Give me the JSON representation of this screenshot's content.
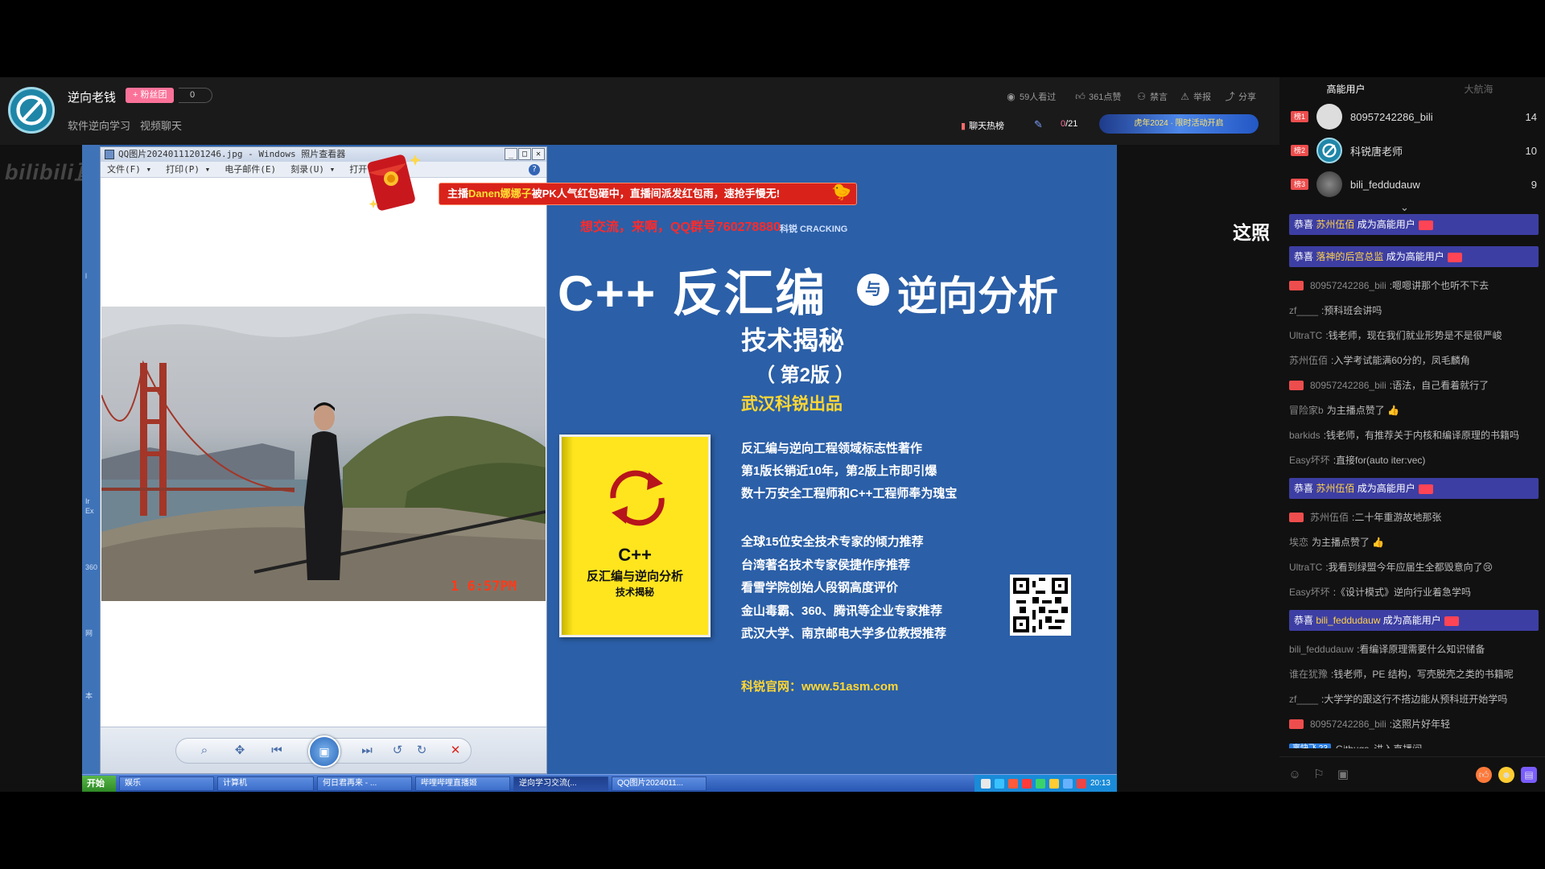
{
  "header": {
    "anchor_name": "逆向老钱",
    "fan_badge": "+ 粉丝团",
    "fan_count": "0",
    "tags": [
      "软件逆向学习",
      "视频聊天"
    ],
    "stats": {
      "viewers": "59人看过",
      "likes": "361点赞",
      "mute": "禁言",
      "report": "举报",
      "share": "分享"
    },
    "hot_rank": "聊天热榜",
    "progress_current": "0",
    "progress_total": "/21",
    "banner_text": "虎年2024 · 限时活动开启"
  },
  "stage": {
    "watermark": "bilibili直播",
    "left_strip_texts": [
      "l",
      "Ir",
      "Ex",
      "360",
      "网",
      "本"
    ],
    "viewer": {
      "title": "QQ图片20240111201246.jpg - Windows 照片查看器",
      "menu": [
        "文件(F) ▾",
        "打印(P) ▾",
        "电子邮件(E)",
        "刻录(U) ▾",
        "打开(O) ▾"
      ],
      "window_buttons": [
        "_",
        "□",
        "✕"
      ],
      "help": "?",
      "photo_timestamp": "1  6:57PM"
    },
    "notice": {
      "prefix": "主播",
      "highlight": "Danen娜娜子",
      "suffix": "被PK人气红包砸中，直播间派发红包雨，速抢手慢无!"
    },
    "poster": {
      "red_line": "想交流，来啊，QQ群号760278880",
      "logo": "科锐 CRACKING",
      "title_left": "C++ 反汇编",
      "title_and": "与",
      "title_right": "逆向分析",
      "subtitle": "技术揭秘",
      "edition": "（ 第2版 ）",
      "publisher": "武汉科锐出品",
      "points_1": [
        "反汇编与逆向工程领域标志性著作",
        "第1版长销近10年，第2版上市即引爆",
        "数十万安全工程师和C++工程师奉为瑰宝"
      ],
      "points_2": [
        "全球15位安全技术专家的倾力推荐",
        "台湾著名技术专家侯捷作序推荐",
        "看雪学院创始人段钢高度评价",
        "金山毒霸、360、腾讯等企业专家推荐",
        "武汉大学、南京邮电大学多位教授推荐"
      ],
      "website": "科锐官网：www.51asm.com",
      "book_title_1": "C++",
      "book_title_2": "反汇编与逆向分析",
      "book_title_3": "技术揭秘"
    },
    "overlay_text": "这照",
    "taskbar": {
      "start": "开始",
      "tasks": [
        "娱乐",
        "计算机",
        "何日君再来 - ...",
        "哔哩哔哩直播姬",
        "逆向学习交流(...",
        "QQ图片2024011..."
      ],
      "time": "20:13"
    }
  },
  "sidebar": {
    "tabs": [
      "高能用户",
      "大航海"
    ],
    "rank": [
      {
        "badge": "榜1",
        "name": "80957242286_bili",
        "score": "14"
      },
      {
        "badge": "榜2",
        "name": "科锐唐老师",
        "score": "10"
      },
      {
        "badge": "榜3",
        "name": "bili_feddudauw",
        "score": "9"
      }
    ],
    "chat": [
      {
        "type": "congrats",
        "prefix": "恭喜",
        "user": "苏州伍佰",
        "suffix": "成为高能用户"
      },
      {
        "type": "congrats",
        "prefix": "恭喜",
        "user": "落神的后宫总监",
        "suffix": "成为高能用户"
      },
      {
        "type": "msg",
        "badge": true,
        "user": "80957242286_bili",
        "text": ":嗯嗯讲那个也听不下去"
      },
      {
        "type": "msg",
        "badge": false,
        "user": "zf____",
        "text": ":预科班会讲吗"
      },
      {
        "type": "msg",
        "badge": false,
        "user": "UltraTC",
        "text": ":钱老师，现在我们就业形势是不是很严峻"
      },
      {
        "type": "msg",
        "badge": false,
        "user": "苏州伍佰",
        "text": ":入学考试能满60分的，凤毛麟角"
      },
      {
        "type": "msg",
        "badge": true,
        "user": "80957242286_bili",
        "text": ":语法，自己看着就行了"
      },
      {
        "type": "msg",
        "badge": false,
        "user": "冒险家b",
        "text": "为主播点赞了 👍"
      },
      {
        "type": "msg",
        "badge": false,
        "user": "barkids",
        "text": ":钱老师，有推荐关于内核和编译原理的书籍吗"
      },
      {
        "type": "msg",
        "badge": false,
        "user": "Easy坏坏",
        "text": ":直接for(auto iter:vec)"
      },
      {
        "type": "congrats",
        "prefix": "恭喜",
        "user": "苏州伍佰",
        "suffix": "成为高能用户"
      },
      {
        "type": "msg",
        "badge": true,
        "user": "苏州伍佰",
        "text": ":二十年重游故地那张"
      },
      {
        "type": "msg",
        "badge": false,
        "user": "埃恋",
        "text": "为主播点赞了 👍"
      },
      {
        "type": "msg",
        "badge": false,
        "user": "UltraTC",
        "text": ":我看到绿盟今年应届生全都毁意向了😢"
      },
      {
        "type": "msg",
        "badge": false,
        "user": "Easy坏坏",
        "text": ":《设计模式》逆向行业着急学吗"
      },
      {
        "type": "congrats",
        "prefix": "恭喜",
        "user": "bili_feddudauw",
        "suffix": "成为高能用户"
      },
      {
        "type": "msg",
        "badge": false,
        "user": "bili_feddudauw",
        "text": ":看编译原理需要什么知识储备"
      },
      {
        "type": "msg",
        "badge": false,
        "user": "谁在犹豫",
        "text": ":钱老师，PE 结构，写壳脱壳之类的书籍呢"
      },
      {
        "type": "msg",
        "badge": false,
        "user": "zf____",
        "text": ":大学学的跟这行不搭边能从预科班开始学吗"
      },
      {
        "type": "msg",
        "badge": true,
        "user": "80957242286_bili",
        "text": ":这照片好年轻"
      }
    ],
    "enter": {
      "badge_name": "离快飞",
      "badge_level": "23",
      "user": "Gitbugs",
      "text": "进入直播间"
    }
  }
}
